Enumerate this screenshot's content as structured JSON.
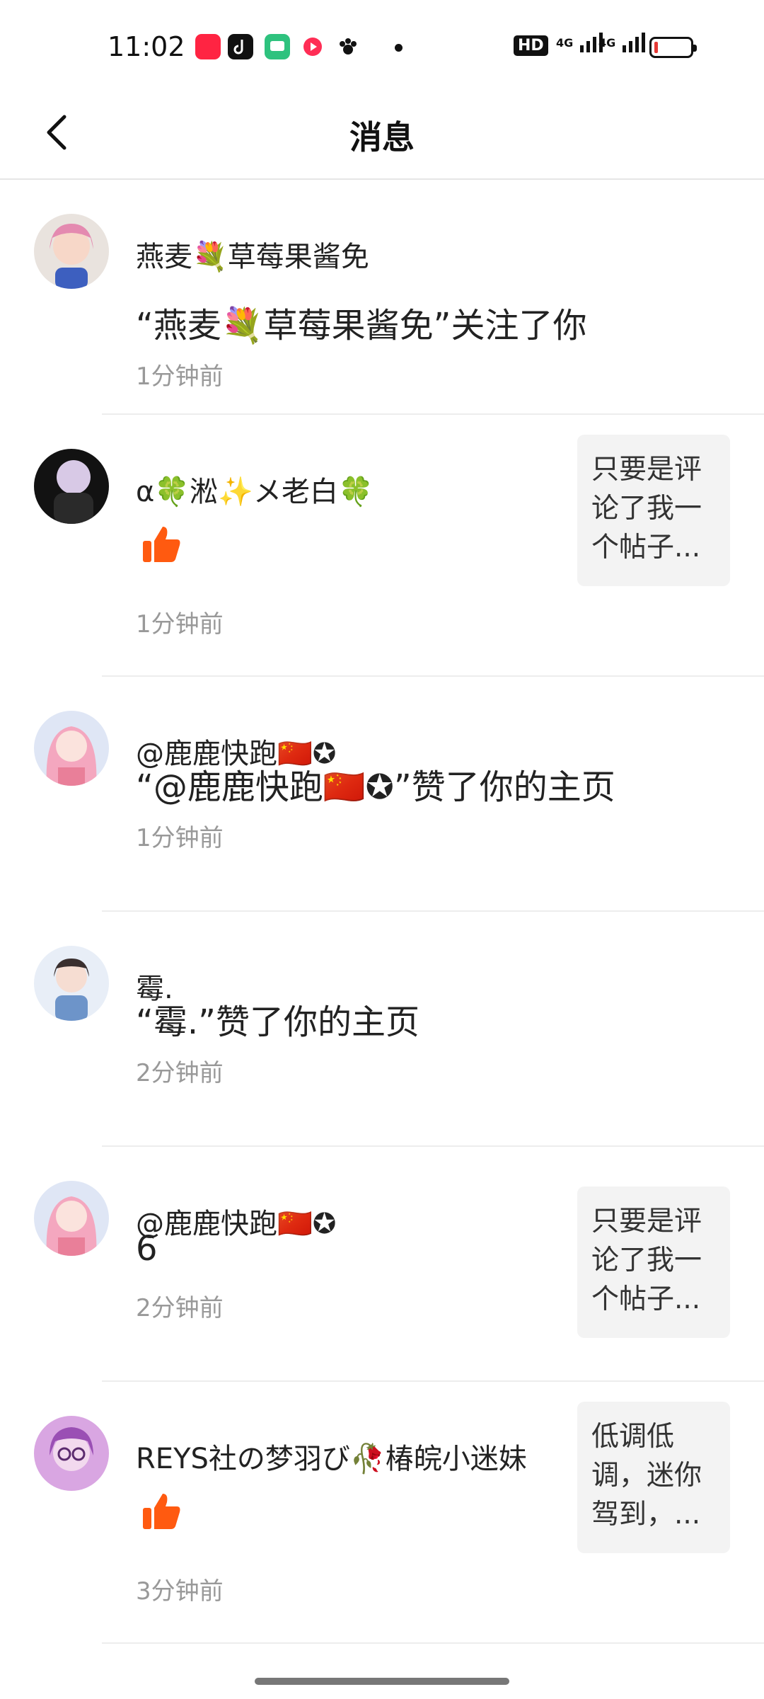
{
  "status_bar": {
    "time": "11:02",
    "app_icons": [
      "xiaohongshu-icon",
      "douyin-icon",
      "chat-icon",
      "video-icon",
      "paw-icon"
    ],
    "right_icons": [
      "hd-icon",
      "signal-4g-icon",
      "signal-4g-icon",
      "battery-low-icon"
    ],
    "hd_label": "HD",
    "net_label_1": "4G",
    "net_label_2": "4G"
  },
  "header": {
    "title": "消息",
    "back_icon": "chevron-left-icon"
  },
  "messages": [
    {
      "name": "燕麦💐草莓果酱免",
      "content": "“燕麦💐草莓果酱免”关注了你",
      "time": "1分钟前",
      "type": "text",
      "avatar_color": "#e8a9c8"
    },
    {
      "name": "α🍀淞✨メ老白🍀",
      "content": "",
      "time": "1分钟前",
      "type": "like",
      "preview": "只要是评论了我一个帖子...",
      "avatar_color": "#1b1b1b"
    },
    {
      "name": "@鹿鹿快跑🇨🇳✪",
      "content": "“@鹿鹿快跑🇨🇳✪”赞了你的主页",
      "time": "1分钟前",
      "type": "text",
      "avatar_color": "#f4b2c6"
    },
    {
      "name": "霉.",
      "content": "“霉.”赞了你的主页",
      "time": "2分钟前",
      "type": "text",
      "avatar_color": "#9fb4d8"
    },
    {
      "name": "@鹿鹿快跑🇨🇳✪",
      "content": "6",
      "time": "2分钟前",
      "type": "text",
      "preview": "只要是评论了我一个帖子...",
      "avatar_color": "#f4b2c6"
    },
    {
      "name": "REYS社の梦羽び🥀椿皖小迷妹",
      "content": "",
      "time": "3分钟前",
      "type": "like",
      "preview": "低调低调，迷你驾到，...",
      "avatar_color": "#c07ad0"
    }
  ],
  "colors": {
    "like": "#ff5a10",
    "timestamp": "#999999",
    "divider": "#ededed"
  }
}
